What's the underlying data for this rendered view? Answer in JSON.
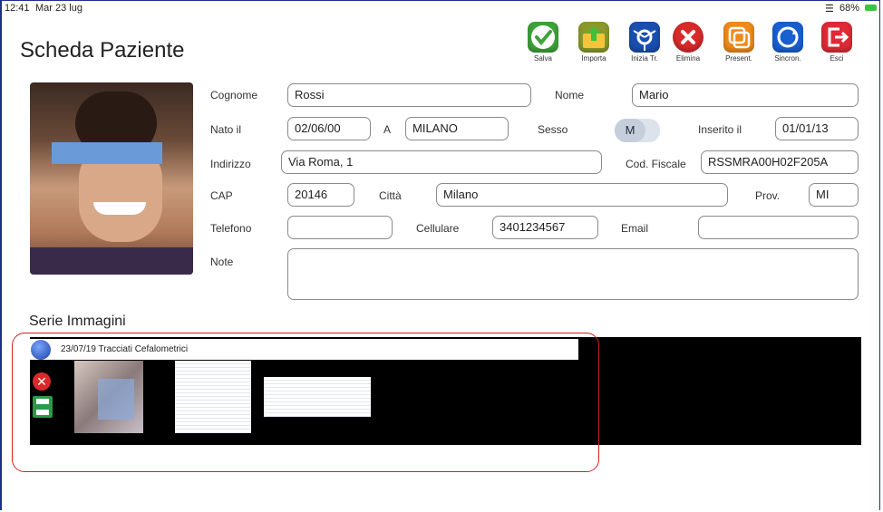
{
  "status_bar": {
    "time": "12:41",
    "date": "Mar 23 lug",
    "battery": "68%"
  },
  "header": {
    "title": "Scheda Paziente"
  },
  "toolbar": [
    {
      "label": "Salva",
      "icon": "checkmark-icon",
      "color": "#3fa33a"
    },
    {
      "label": "Importa",
      "icon": "folder-import-icon",
      "color": "#8a9a2a"
    },
    {
      "label": "Inizia Tr.",
      "icon": "trace-start-icon",
      "color": "#1a4fb0"
    },
    {
      "label": "Elimina",
      "icon": "delete-icon",
      "color": "#d82a2a"
    },
    {
      "label": "Present.",
      "icon": "presentation-icon",
      "color": "#ef8a1a"
    },
    {
      "label": "Sincron.",
      "icon": "sync-icon",
      "color": "#1a5fcf"
    },
    {
      "label": "Esci",
      "icon": "exit-icon",
      "color": "#e02a35"
    }
  ],
  "form": {
    "cognome": {
      "label": "Cognome",
      "value": "Rossi"
    },
    "nome": {
      "label": "Nome",
      "value": "Mario"
    },
    "nato_il": {
      "label": "Nato il",
      "value": "02/06/00"
    },
    "a": {
      "label": "A",
      "value": "MILANO"
    },
    "sesso": {
      "label": "Sesso",
      "value": "M"
    },
    "inserito_il": {
      "label": "Inserito il",
      "value": "01/01/13"
    },
    "indirizzo": {
      "label": "Indirizzo",
      "value": "Via Roma, 1"
    },
    "cod_fiscale": {
      "label": "Cod. Fiscale",
      "value": "RSSMRA00H02F205A"
    },
    "cap": {
      "label": "CAP",
      "value": "20146"
    },
    "citta": {
      "label": "Città",
      "value": "Milano"
    },
    "prov": {
      "label": "Prov.",
      "value": "MI"
    },
    "telefono": {
      "label": "Telefono",
      "value": ""
    },
    "cellulare": {
      "label": "Cellulare",
      "value": "3401234567"
    },
    "email": {
      "label": "Email",
      "value": ""
    },
    "note": {
      "label": "Note",
      "value": ""
    }
  },
  "series": {
    "title": "Serie Immagini",
    "entries": [
      {
        "label": "23/07/19 Tracciati Cefalometrici",
        "thumbnails": 3
      }
    ]
  }
}
